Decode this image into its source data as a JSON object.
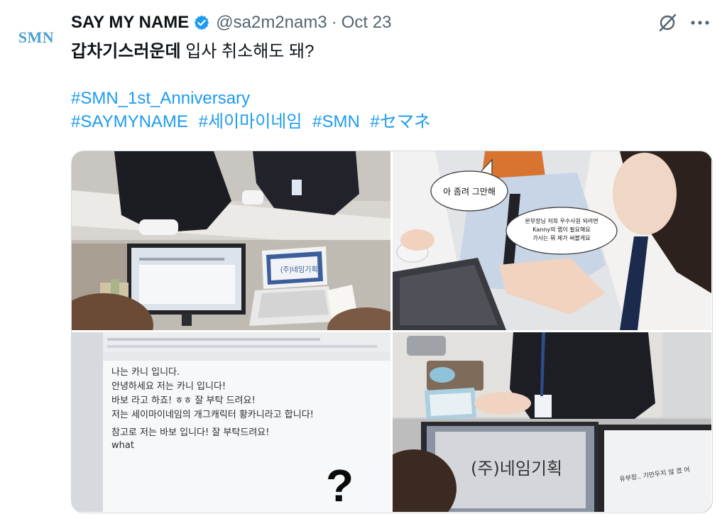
{
  "author": {
    "avatar_text": "SMN",
    "display_name": "SAY MY NAME",
    "handle": "@sa2m2nam3",
    "separator": "·",
    "date": "Oct 23",
    "verified": true
  },
  "tweet": {
    "text_bold": "갑차기스러운데",
    "text_rest": " 입사 취소해도 돼?",
    "hashtags_line1": [
      "#SMN_1st_Anniversary"
    ],
    "hashtags_line2": [
      "#SAYMYNAME",
      "#세이마이네임",
      "#SMN",
      "#セマネ"
    ]
  },
  "icons": {
    "grok": "grok-icon",
    "more": "more-icon",
    "verified": "verified-badge-icon"
  },
  "colors": {
    "accent": "#1d9bf0",
    "muted": "#536471",
    "text": "#0f1419"
  },
  "media": [
    {
      "name": "photo-office-desk-laptop",
      "slide_title": "(주)네임기획"
    },
    {
      "name": "photo-computer-mouse-speech-bubbles",
      "bubble1": "아 좀려 그만해",
      "bubble2": [
        "본부장님 저희 우수사원 되려면",
        "Kanny의 랩이 필요해요",
        "가사는 뭐 제가 써볼게요"
      ]
    },
    {
      "name": "photo-screen-document-text",
      "lines": [
        "나는 카니 입니다.",
        "안녕하세요 저는 카니 입니다!",
        "바보 라고 하죠! ㅎㅎ 잘 부탁 드려요!",
        "저는 세이마이네임의 개그캐릭터 황카니라고 합니다!",
        "",
        "참고로 저는 바보 입니다! 잘 부탁드려요!",
        "what"
      ],
      "mark": "?"
    },
    {
      "name": "photo-keyboard-monitor-name",
      "slide_title": "(주)네임기획",
      "side_text": "유부장.. 기만두지 않 겠 어"
    }
  ]
}
